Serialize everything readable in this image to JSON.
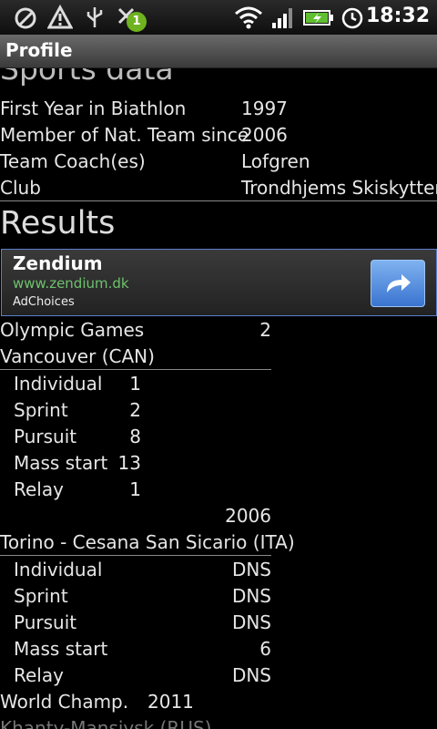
{
  "status": {
    "time": "18:32",
    "badge": "1"
  },
  "header": {
    "title": "Profile"
  },
  "sports_data": {
    "heading": "Sports data",
    "rows": [
      {
        "label": "First Year in Biathlon",
        "value": "1997"
      },
      {
        "label": "Member of Nat. Team since",
        "value": "2006"
      },
      {
        "label": "Team Coach(es)",
        "value": "Lofgren"
      },
      {
        "label": "Club",
        "value": "Trondhjems Skiskyttere"
      }
    ]
  },
  "results": {
    "heading": "Results",
    "olympic": {
      "label": "Olympic Games",
      "count": "2"
    },
    "vancouver": {
      "title": "Vancouver (CAN)",
      "events": [
        {
          "name": "Individual",
          "value": "1"
        },
        {
          "name": "Sprint",
          "value": "2"
        },
        {
          "name": "Pursuit",
          "value": "8"
        },
        {
          "name": "Mass start",
          "value": "13"
        },
        {
          "name": "Relay",
          "value": "1"
        }
      ]
    },
    "torino_year": "2006",
    "torino": {
      "title": "Torino - Cesana San Sicario (ITA)",
      "events": [
        {
          "name": "Individual",
          "value": "DNS"
        },
        {
          "name": "Sprint",
          "value": "DNS"
        },
        {
          "name": "Pursuit",
          "value": "DNS"
        },
        {
          "name": "Mass start",
          "value": "6"
        },
        {
          "name": "Relay",
          "value": "DNS"
        }
      ]
    },
    "world": {
      "label": "World Champ.",
      "year": "2011"
    },
    "next_partial": "Khanty-Mansiysk (RUS)"
  },
  "ad": {
    "name": "Zendium",
    "url": "www.zendium.dk",
    "choices": "AdChoices"
  }
}
